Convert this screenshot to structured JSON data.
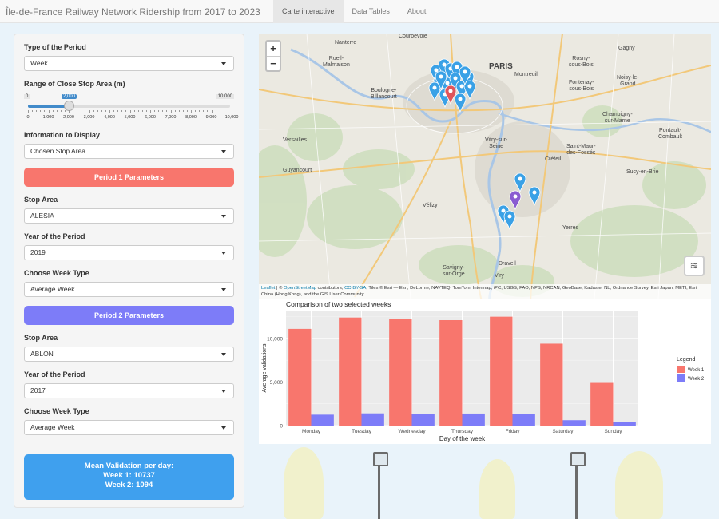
{
  "app_title": "Île-de-France Railway Network Ridership from 2017 to 2023",
  "nav": {
    "tabs": [
      "Carte interactive",
      "Data Tables",
      "About"
    ],
    "active": 0
  },
  "sidebar": {
    "period_type": {
      "label": "Type of the Period",
      "value": "Week"
    },
    "range": {
      "label": "Range of Close Stop Area (m)",
      "min_label": "0",
      "max_label": "10,000",
      "value_label": "2,000",
      "value": 2000,
      "min": 0,
      "max": 10000,
      "ticks": [
        "0",
        "1,000",
        "2,000",
        "3,000",
        "4,000",
        "5,000",
        "6,000",
        "7,000",
        "8,000",
        "9,000",
        "10,000"
      ]
    },
    "info": {
      "label": "Information to Display",
      "value": "Chosen Stop Area"
    },
    "period1": {
      "button": "Period 1 Parameters",
      "stop_area_label": "Stop Area",
      "stop_area": "ALESIA",
      "year_label": "Year of the Period",
      "year": "2019",
      "week_type_label": "Choose Week Type",
      "week_type": "Average Week"
    },
    "period2": {
      "button": "Period 2 Parameters",
      "stop_area_label": "Stop Area",
      "stop_area": "ABLON",
      "year_label": "Year of the Period",
      "year": "2017",
      "week_type_label": "Choose Week Type",
      "week_type": "Average Week"
    },
    "mean": {
      "title": "Mean Validation per day:",
      "week1": "Week 1: 10737",
      "week2": "Week 2: 1094"
    }
  },
  "map": {
    "zoom_in": "+",
    "zoom_out": "−",
    "attribution": {
      "leaflet": "Leaflet",
      "sep1": " | © ",
      "osm": "OpenStreetMap",
      "contributors": " contributors, ",
      "ccbysa": "CC-BY-SA",
      "tiles": ", Tiles © Esri — Esri, DeLorme, NAVTEQ, TomTom, Intermap, iPC, USGS, FAO, NPS, NRCAN, GeoBase, Kadaster NL, Ordnance Survey, Esri Japan, METI, Esri China (Hong Kong), and the GIS User Community"
    },
    "place_labels": [
      "Nanterre",
      "Courbevoie",
      "Rueil-\nMalmaison",
      "Boulogne-\nBillancourt",
      "PARIS",
      "Montreuil",
      "Rosny-\nsous-Bois",
      "Fontenay-\nsous-Bois",
      "Noisy-le-\nGrand",
      "Gagny",
      "Champigny-\nsur-Marne",
      "Vitry-sur-\nSeine",
      "Versailles",
      "Saint-Maur-\ndes-Fossés",
      "Créteil",
      "Pontault-\nCombault",
      "Guyancourt",
      "Sucy-en-Brie",
      "Yerres",
      "Draveil",
      "Savigny-\nsur-Orge",
      "Viry",
      "Vélizy"
    ],
    "pin_colors": {
      "blue": "#3aa1e6",
      "red": "#e0555b",
      "purple": "#8a5bd1"
    }
  },
  "chart_data": {
    "type": "bar",
    "title": "Comparison of two selected weeks",
    "xlabel": "Day of the week",
    "ylabel": "Average validations",
    "categories": [
      "Monday",
      "Tuesday",
      "Wednesday",
      "Thursday",
      "Friday",
      "Saturday",
      "Sunday"
    ],
    "series": [
      {
        "name": "Week 1",
        "color": "#f8766d",
        "values": [
          11100,
          12400,
          12200,
          12100,
          12500,
          9400,
          4900
        ]
      },
      {
        "name": "Week 2",
        "color": "#7d7cf8",
        "values": [
          1250,
          1400,
          1350,
          1380,
          1350,
          620,
          380
        ]
      }
    ],
    "ylim": [
      0,
      13200
    ],
    "yticks": [
      0,
      5000,
      10000
    ],
    "ytick_labels": [
      "0",
      "5,000",
      "10,000"
    ],
    "legend_title": "Legend",
    "legend_position": "right",
    "grid": true
  }
}
